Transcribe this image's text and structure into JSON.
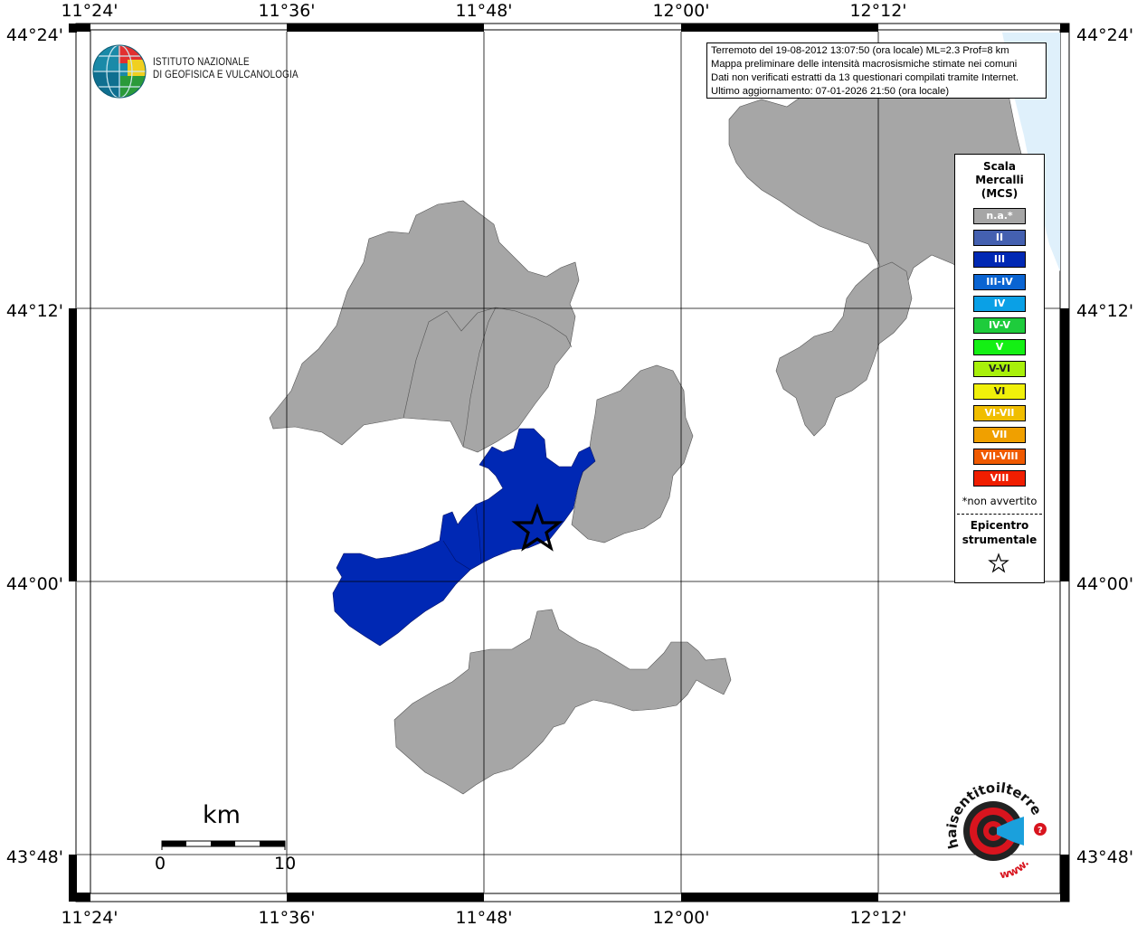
{
  "map": {
    "lon_labels": [
      "11°24'",
      "11°36'",
      "11°48'",
      "12°00'",
      "12°12'"
    ],
    "lat_labels": [
      "44°24'",
      "44°12'",
      "44°00'",
      "43°48'"
    ],
    "scale_unit": "km",
    "scale_start": "0",
    "scale_end": "10",
    "epicenter_marker": "star-icon"
  },
  "info": {
    "line1": "Terremoto del 19-08-2012 13:07:50 (ora locale) ML=2.3 Prof=8 km",
    "line2": "Mappa preliminare delle intensità macrosismiche stimate nei comuni",
    "line3": "Dati non verificati estratti da 13 questionari compilati tramite Internet.",
    "line4": "Ultimo aggiornamento: 07-01-2026 21:50 (ora locale)"
  },
  "logo": {
    "line1": "ISTITUTO NAZIONALE",
    "line2": "DI GEOFISICA E VULCANOLOGIA",
    "hst_text": "haisentitoilterremoto.it",
    "hst_www": "www."
  },
  "legend": {
    "title_line1": "Scala",
    "title_line2": "Mercalli",
    "title_line3": "(MCS)",
    "items": [
      {
        "label": "n.a.*",
        "color": "#a6a6a6"
      },
      {
        "label": "II",
        "color": "#4460b0"
      },
      {
        "label": "III",
        "color": "#0028b4"
      },
      {
        "label": "III-IV",
        "color": "#0a64d2"
      },
      {
        "label": "IV",
        "color": "#0aa0e6"
      },
      {
        "label": "IV-V",
        "color": "#1ecc3c"
      },
      {
        "label": "V",
        "color": "#14f014"
      },
      {
        "label": "V-VI",
        "color": "#a8f00a"
      },
      {
        "label": "VI",
        "color": "#f0f00a"
      },
      {
        "label": "VI-VII",
        "color": "#f0be00"
      },
      {
        "label": "VII",
        "color": "#f0a000"
      },
      {
        "label": "VII-VIII",
        "color": "#f05a00"
      },
      {
        "label": "VIII",
        "color": "#f01e00"
      }
    ],
    "note": "*non avvertito",
    "epicenter_line1": "Epicentro",
    "epicenter_line2": "strumentale"
  },
  "colors": {
    "not_felt": "#a6a6a6",
    "intensity_III": "#0028b4",
    "sea": "#dff0fb"
  }
}
